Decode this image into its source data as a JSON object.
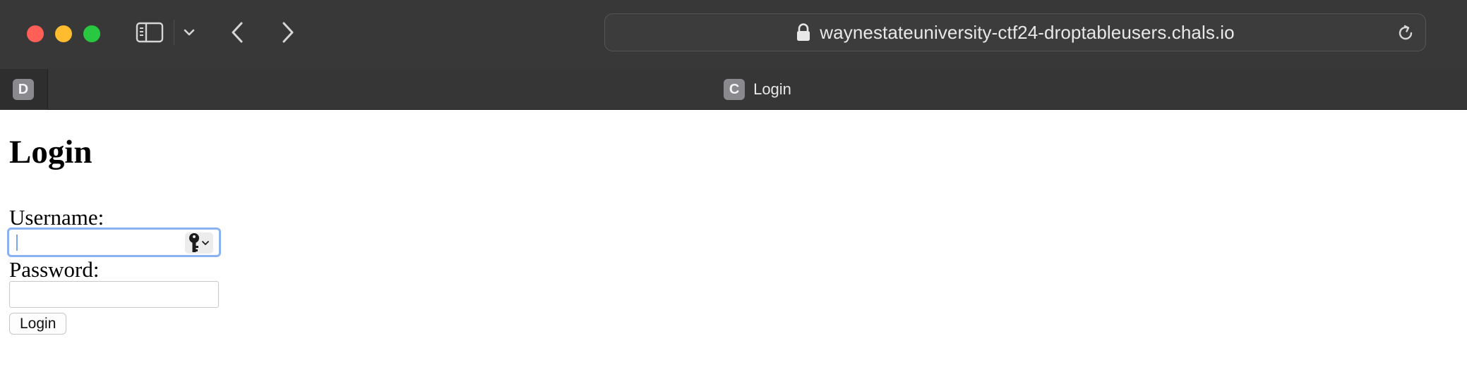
{
  "browser": {
    "url": "waynestateuniversity-ctf24-droptableusers.chals.io",
    "icons": {
      "sidebar": "sidebar-icon",
      "sidebar_menu": "chevron-down-icon",
      "back": "chevron-left-icon",
      "forward": "chevron-right-icon",
      "lock": "lock-icon",
      "reload": "reload-icon"
    },
    "colors": {
      "close": "#ff5f57",
      "minimize": "#febc2e",
      "maximize": "#28c840"
    }
  },
  "tabs": {
    "pinned": {
      "favicon_letter": "D"
    },
    "active": {
      "favicon_letter": "C",
      "title": "Login"
    }
  },
  "page": {
    "title": "Login",
    "username_label": "Username:",
    "username_value": "",
    "password_label": "Password:",
    "password_value": "",
    "submit_label": "Login",
    "focus_color": "#8bb2f0",
    "keychain_icon": "key-icon"
  }
}
